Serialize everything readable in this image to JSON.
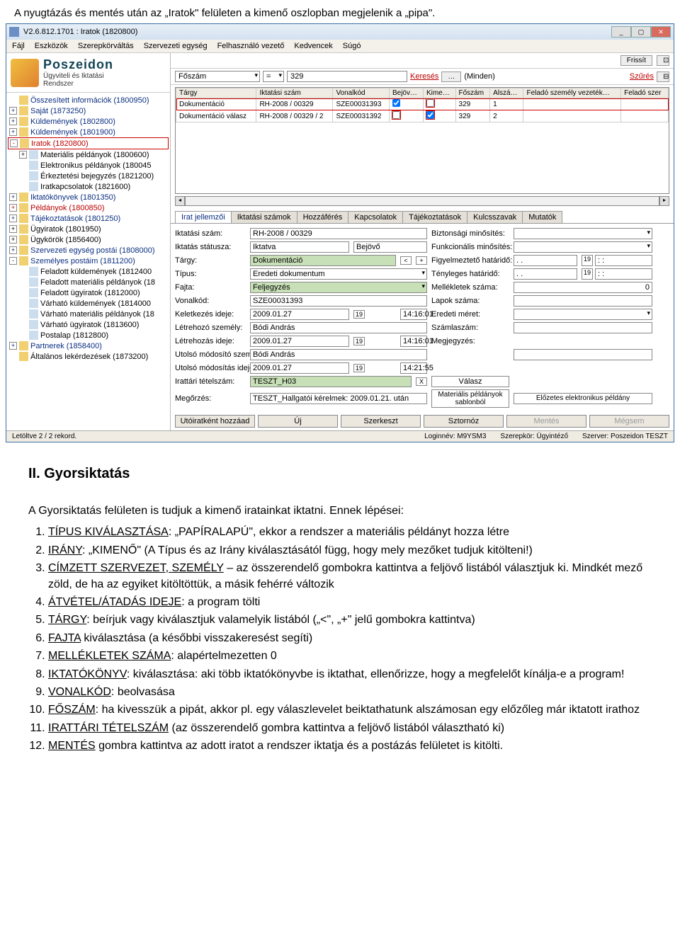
{
  "doc_intro": "A nyugtázás és mentés után az „Iratok\" felületen a kimenő oszlopban megjelenik a „pipa\".",
  "window": {
    "title": "V2.6.812.1701 : Iratok (1820800)",
    "menu": [
      "Fájl",
      "Eszközök",
      "Szerepkörváltás",
      "Szervezeti egység",
      "Felhasználó vezető",
      "Kedvencek",
      "Súgó"
    ],
    "logo": {
      "l1": "Poszeidon",
      "l2": "Ügyviteli és Iktatási",
      "l3": "Rendszer"
    },
    "tree": [
      {
        "t": "Összesített információk (1800950)",
        "lvl": 0,
        "exp": "",
        "cls": "blue"
      },
      {
        "t": "Saját (1873250)",
        "lvl": 0,
        "exp": "+",
        "cls": "blue"
      },
      {
        "t": "Küldemények (1802800)",
        "lvl": 0,
        "exp": "+",
        "cls": "blue"
      },
      {
        "t": "Küldemények (1801900)",
        "lvl": 0,
        "exp": "+",
        "cls": "blue"
      },
      {
        "t": "Iratok (1820800)",
        "lvl": 0,
        "exp": "-",
        "cls": "red sel"
      },
      {
        "t": "Materiális példányok (1800600)",
        "lvl": 1,
        "exp": "+",
        "cls": ""
      },
      {
        "t": "Elektronikus példányok (180045",
        "lvl": 1,
        "exp": "",
        "cls": ""
      },
      {
        "t": "Érkeztetési bejegyzés (1821200)",
        "lvl": 1,
        "exp": "",
        "cls": ""
      },
      {
        "t": "Iratkapcsolatok (1821600)",
        "lvl": 1,
        "exp": "",
        "cls": ""
      },
      {
        "t": "Iktatókönyvek (1801350)",
        "lvl": 0,
        "exp": "+",
        "cls": "blue"
      },
      {
        "t": "Példányok (1800850)",
        "lvl": 0,
        "exp": "+",
        "cls": "red"
      },
      {
        "t": "Tájékoztatások (1801250)",
        "lvl": 0,
        "exp": "+",
        "cls": "blue"
      },
      {
        "t": "Ügyiratok (1801950)",
        "lvl": 0,
        "exp": "+",
        "cls": ""
      },
      {
        "t": "Ügykörök (1856400)",
        "lvl": 0,
        "exp": "+",
        "cls": ""
      },
      {
        "t": "Szervezeti egység postái (1808000)",
        "lvl": 0,
        "exp": "+",
        "cls": "blue"
      },
      {
        "t": "Személyes postáim (1811200)",
        "lvl": 0,
        "exp": "-",
        "cls": "blue"
      },
      {
        "t": "Feladott küldemények (1812400",
        "lvl": 1,
        "exp": "",
        "cls": ""
      },
      {
        "t": "Feladott materiális példányok (18",
        "lvl": 1,
        "exp": "",
        "cls": ""
      },
      {
        "t": "Feladott ügyiratok (1812000)",
        "lvl": 1,
        "exp": "",
        "cls": ""
      },
      {
        "t": "Várható küldemények (1814000",
        "lvl": 1,
        "exp": "",
        "cls": ""
      },
      {
        "t": "Várható materiális példányok (18",
        "lvl": 1,
        "exp": "",
        "cls": ""
      },
      {
        "t": "Várható ügyiratok (1813600)",
        "lvl": 1,
        "exp": "",
        "cls": ""
      },
      {
        "t": "Postalap (1812800)",
        "lvl": 1,
        "exp": "",
        "cls": ""
      },
      {
        "t": "Partnerek (1858400)",
        "lvl": 0,
        "exp": "+",
        "cls": "blue"
      },
      {
        "t": "Általános lekérdezések (1873200)",
        "lvl": 0,
        "exp": "",
        "cls": ""
      }
    ],
    "toolbar": {
      "refresh": "Frissít",
      "filter": "Szűrés"
    },
    "search": {
      "field": "Főszám",
      "op": "=",
      "val": "329",
      "go": "Keresés",
      "dots": "…",
      "scope": "(Minden)"
    },
    "grid": {
      "headers": [
        "Tárgy",
        "Iktatási szám",
        "Vonalkód",
        "Bejöv…",
        "Kime…",
        "Főszám",
        "Alszá…",
        "Feladó személy vezeték…",
        "Feladó szer"
      ],
      "rows": [
        [
          "Dokumentáció",
          "RH-2008 / 00329",
          "SZE00031393",
          "1",
          "",
          "329",
          "1",
          "",
          ""
        ],
        [
          "Dokumentáció válasz",
          "RH-2008 / 00329 / 2",
          "SZE00031392",
          "",
          "1",
          "329",
          "2",
          "",
          ""
        ]
      ]
    },
    "tabs": [
      "Irat jellemzői",
      "Iktatási számok",
      "Hozzáférés",
      "Kapcsolatok",
      "Tájékoztatások",
      "Kulcsszavak",
      "Mutatók"
    ],
    "form": {
      "iktatasi_szam": {
        "lbl": "Iktatási szám:",
        "val": "RH-2008 / 00329"
      },
      "iktatas_statusza": {
        "lbl": "Iktatás státusza:",
        "v1": "Iktatva",
        "v2": "Bejövő"
      },
      "targy": {
        "lbl": "Tárgy:",
        "val": "Dokumentáció"
      },
      "tipus": {
        "lbl": "Típus:",
        "val": "Eredeti dokumentum"
      },
      "fajta": {
        "lbl": "Fajta:",
        "val": "Feljegyzés"
      },
      "vonalkod": {
        "lbl": "Vonalkód:",
        "val": "SZE00031393"
      },
      "keletkezes": {
        "lbl": "Keletkezés ideje:",
        "d": "2009.01.27",
        "t": "14:16:01"
      },
      "letrehozo": {
        "lbl": "Létrehozó személy:",
        "val": "Bódi András"
      },
      "letrehozas": {
        "lbl": "Létrehozás ideje:",
        "d": "2009.01.27",
        "t": "14:16:01"
      },
      "modosito": {
        "lbl": "Utolsó módosító személy:",
        "val": "Bódi András"
      },
      "modositas": {
        "lbl": "Utolsó módosítás ideje:",
        "d": "2009.01.27",
        "t": "14:21:55"
      },
      "irattari": {
        "lbl": "Irattári tételszám:",
        "val": "TESZT_H03"
      },
      "megorzes": {
        "lbl": "Megőrzés:",
        "val": "TESZT_Hallgatói kérelmek: 2009.01.21. után"
      },
      "biztonsagi": {
        "lbl": "Biztonsági minősítés:"
      },
      "funkcionalis": {
        "lbl": "Funkcionális minősítés:"
      },
      "figyelmezteto": {
        "lbl": "Figyelmeztető határidő:"
      },
      "tenyleges": {
        "lbl": "Tényleges határidő:"
      },
      "mellekletek": {
        "lbl": "Mellékletek száma:",
        "val": "0"
      },
      "lapok": {
        "lbl": "Lapok száma:"
      },
      "eredeti": {
        "lbl": "Eredeti méret:"
      },
      "szamlaszam": {
        "lbl": "Számlaszám:"
      },
      "megjegyzes": {
        "lbl": "Megjegyzés:"
      },
      "valasz": "Válasz",
      "mat_sablon": "Materiális példányok sablonból",
      "elozetes": "Előzetes elektronikus példány"
    },
    "actions": [
      "Utóiratként hozzáad",
      "Új",
      "Szerkeszt",
      "Sztornóz",
      "Mentés",
      "Mégsem"
    ],
    "status": {
      "rec": "Letöltve 2 / 2 rekord.",
      "login": "Loginnév: M9YSM3",
      "role": "Szerepkör: Ügyintéző",
      "srv": "Szerver: Poszeidon TESZT"
    }
  },
  "section2": {
    "h": "II.      Gyorsiktatás",
    "p": "A Gyorsiktatás felületen is tudjuk a kimenő iratainkat iktatni. Ennek lépései:",
    "items": [
      "TÍPUS KIVÁLASZTÁSA: „PAPÍRALAPÚ\", ekkor a rendszer a materiális példányt hozza létre",
      "IRÁNY: „KIMENŐ\" (A Típus és az Irány kiválasztásától függ, hogy mely mezőket tudjuk kitölteni!)",
      "CÍMZETT SZERVEZET, SZEMÉLY – az összerendelő gombokra kattintva a feljövő listából választjuk ki. Mindkét mező zöld, de ha az egyiket kitöltöttük, a másik fehérré változik",
      "ÁTVÉTEL/ÁTADÁS IDEJE: a program tölti",
      "TÁRGY: beírjuk vagy kiválasztjuk valamelyik listából („<\", „+\" jelű gombokra kattintva)",
      "FAJTA kiválasztása (a későbbi visszakeresést segíti)",
      "MELLÉKLETEK SZÁMA: alapértelmezetten 0",
      "IKTATÓKÖNYV: kiválasztása: aki több iktatókönyvbe is iktathat, ellenőrizze, hogy a megfelelőt kínálja-e a program!",
      "VONALKÓD: beolvasása",
      "FŐSZÁM: ha kivesszük a pipát, akkor pl. egy válaszlevelet beiktathatunk alszámosan egy előzőleg már iktatott irathoz",
      "IRATTÁRI TÉTELSZÁM (az összerendelő gombra kattintva a feljövő listából választható ki)",
      "MENTÉS gombra kattintva az adott iratot a rendszer iktatja és a postázás felületet is kitölti."
    ]
  }
}
